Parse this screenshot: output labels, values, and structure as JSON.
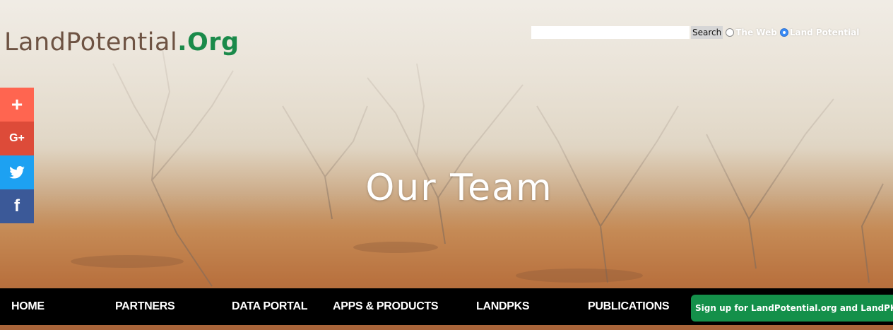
{
  "logo": {
    "part1": "LandPotential",
    "part2": ".Org"
  },
  "search": {
    "button_label": "Search",
    "radio_options": [
      {
        "label": "The Web",
        "checked": false
      },
      {
        "label": "Land Potential",
        "checked": true
      }
    ]
  },
  "social": [
    {
      "icon": "plus-icon",
      "glyph": "+",
      "color": "#ff6550"
    },
    {
      "icon": "google-plus-icon",
      "glyph": "G+",
      "color": "#dd4b39"
    },
    {
      "icon": "twitter-icon",
      "glyph": "",
      "color": "#1da1f2"
    },
    {
      "icon": "facebook-icon",
      "glyph": "f",
      "color": "#3b5998"
    }
  ],
  "hero": {
    "title": "Our Team"
  },
  "nav": {
    "items": [
      "HOME",
      "PARTNERS",
      "DATA PORTAL",
      "APPS & PRODUCTS",
      "LANDPKS",
      "PUBLICATIONS"
    ],
    "signup_label": "Sign up for LandPotential.org and LandPKS updates"
  },
  "colors": {
    "brand_brown": "#6e5343",
    "brand_green": "#1a8a4a",
    "nav_bg": "#000000",
    "signup_bg": "#14904a"
  }
}
